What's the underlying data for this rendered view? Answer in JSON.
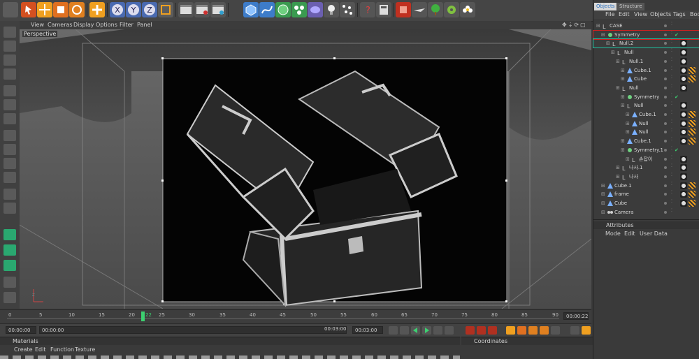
{
  "object_tabs": [
    "Objects",
    "Structure"
  ],
  "object_menu": [
    "File",
    "Edit",
    "View",
    "Objects",
    "Tags",
    "Boo"
  ],
  "objects": [
    {
      "label": "CASE",
      "depth": 0,
      "icon": "null"
    },
    {
      "label": "Symmetry",
      "depth": 1,
      "icon": "symmetry",
      "check": "✔"
    },
    {
      "label": "Null.2",
      "depth": 2,
      "icon": "null"
    },
    {
      "label": "Null",
      "depth": 3,
      "icon": "null"
    },
    {
      "label": "Null.1",
      "depth": 4,
      "icon": "null"
    },
    {
      "label": "Cube.1",
      "depth": 5,
      "icon": "cube"
    },
    {
      "label": "Cube",
      "depth": 5,
      "icon": "cube"
    },
    {
      "label": "Null",
      "depth": 4,
      "icon": "null"
    },
    {
      "label": "Symmetry",
      "depth": 5,
      "icon": "symmetry",
      "check": "✔"
    },
    {
      "label": "Null",
      "depth": 5,
      "icon": "null"
    },
    {
      "label": "Cube.1",
      "depth": 6,
      "icon": "cube"
    },
    {
      "label": "Null",
      "depth": 6,
      "icon": "cube"
    },
    {
      "label": "Null",
      "depth": 6,
      "icon": "cube"
    },
    {
      "label": "Cube.1",
      "depth": 5,
      "icon": "cube"
    },
    {
      "label": "Symmetry.1",
      "depth": 5,
      "icon": "symmetry",
      "check": "✔"
    },
    {
      "label": "손잡이",
      "depth": 6,
      "icon": "null"
    },
    {
      "label": "나사.1",
      "depth": 4,
      "icon": "null"
    },
    {
      "label": "나사",
      "depth": 4,
      "icon": "null"
    },
    {
      "label": "Cube.1",
      "depth": 1,
      "icon": "cube"
    },
    {
      "label": "frame",
      "depth": 1,
      "icon": "cube"
    },
    {
      "label": "Cube",
      "depth": 1,
      "icon": "cube"
    },
    {
      "label": "Camera",
      "depth": 1,
      "icon": "camera"
    }
  ],
  "attributes": {
    "title": "Attributes",
    "menu": [
      "Mode",
      "Edit",
      "User Data"
    ]
  },
  "viewport": {
    "label": "Perspective",
    "menu": [
      "View",
      "Cameras",
      "Display",
      "Options",
      "Filter",
      "Panel"
    ]
  },
  "timeline": {
    "ticks": [
      "0",
      "5",
      "10",
      "15",
      "20",
      "25",
      "30",
      "35",
      "40",
      "45",
      "50",
      "55",
      "60",
      "65",
      "70",
      "75",
      "80",
      "85",
      "90"
    ],
    "current_frame": "22",
    "frame_readout": "00:00:22"
  },
  "transport": {
    "start": "00:00:00",
    "range_start": "00:00:00",
    "range_end": "00:03:00",
    "end": "00:03:00"
  },
  "materials": {
    "title": "Materials",
    "menu": [
      "Create",
      "Edit",
      "Function",
      "Texture"
    ]
  },
  "coordinates": {
    "title": "Coordinates"
  },
  "colors": {
    "accent_orange": "#f0a020",
    "selection_red": "#d02020",
    "selection_green": "#20c0a0",
    "ui_bg": "#3b3b3b"
  }
}
